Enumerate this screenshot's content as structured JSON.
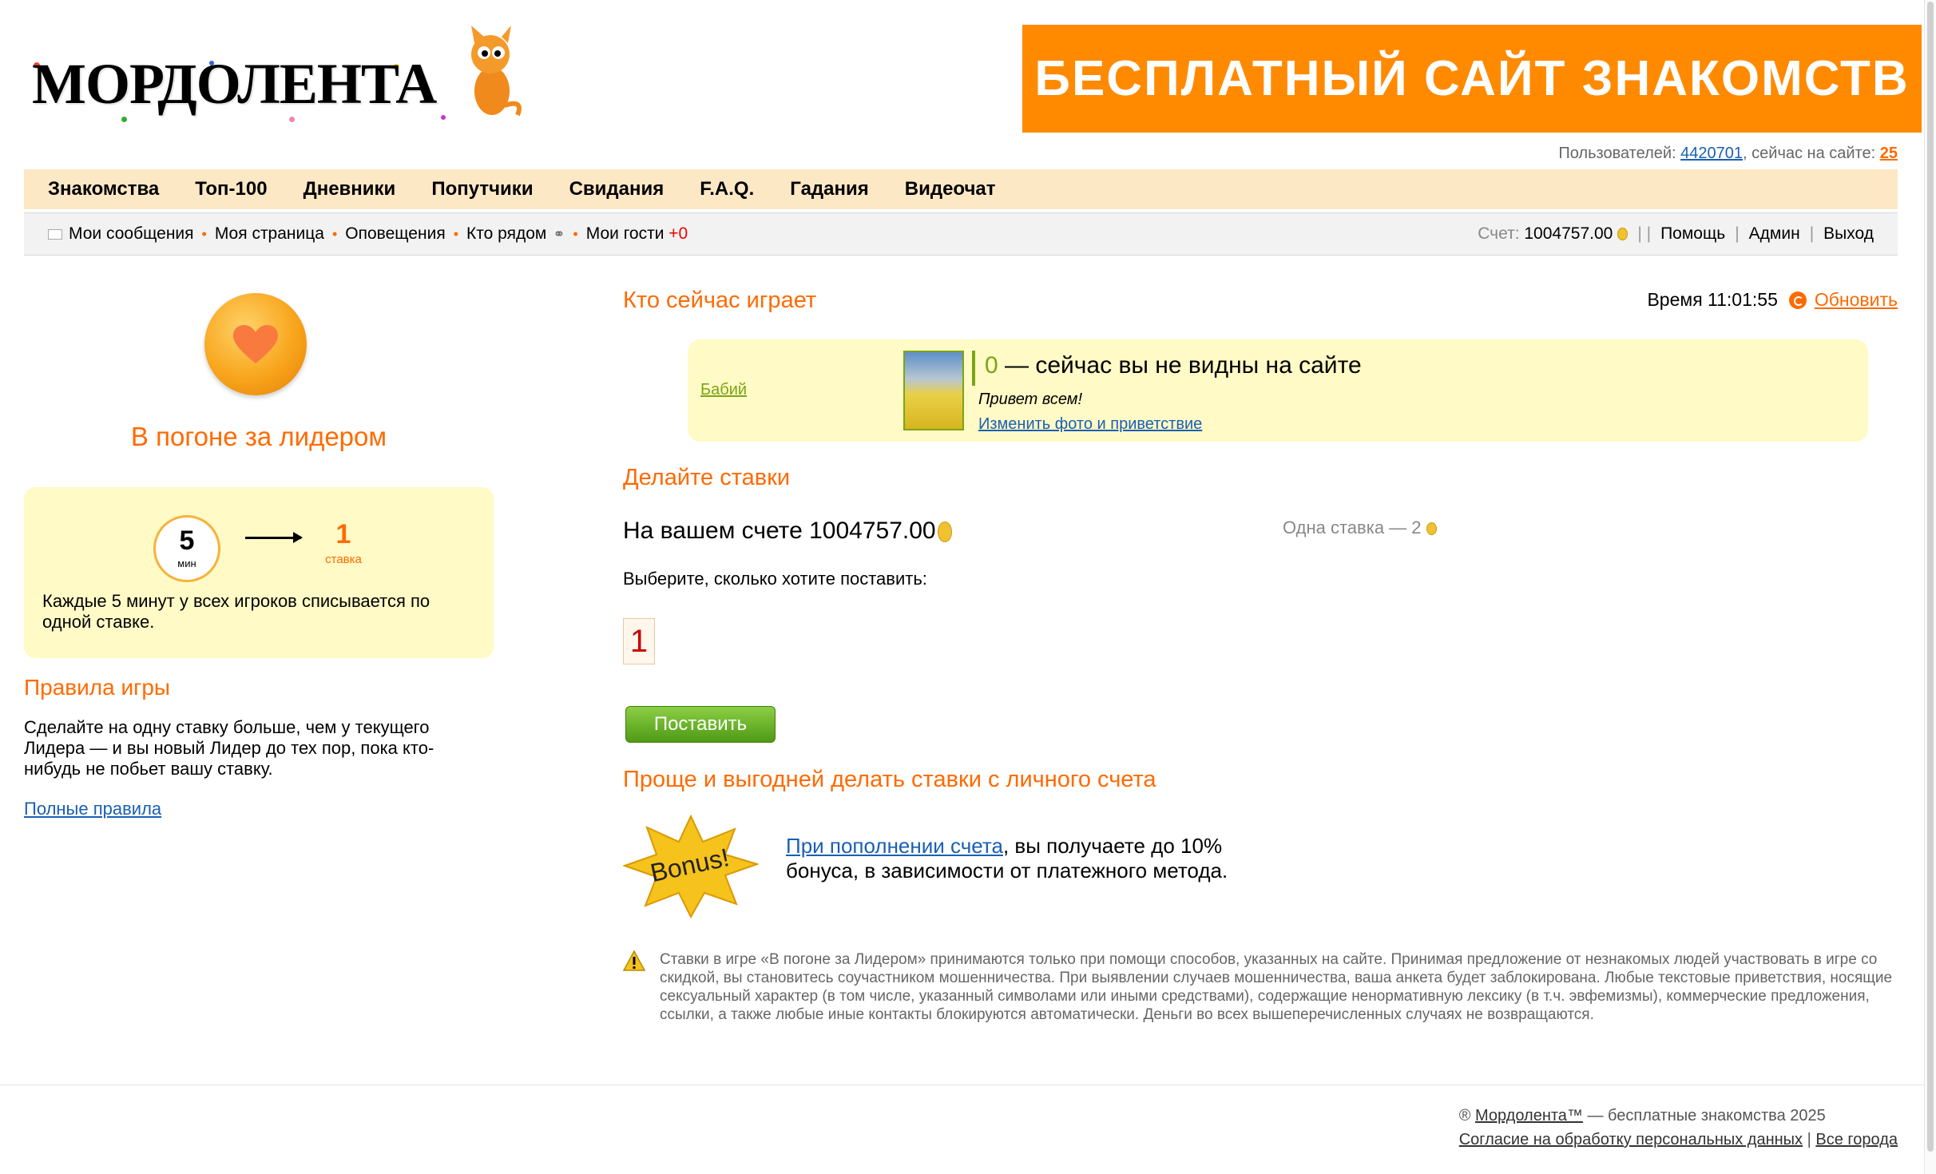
{
  "header": {
    "logo_text": "МОРДОЛЕНТА",
    "banner_text": "БЕСПЛАТНЫЙ САЙТ ЗНАКОМСТВ",
    "users_label": "Пользователей:",
    "users_count": "4420701",
    "online_label": ", сейчас на сайте:",
    "online_count": "25"
  },
  "main_nav": [
    "Знакомства",
    "Топ-100",
    "Дневники",
    "Попутчики",
    "Свидания",
    "F.A.Q.",
    "Гадания",
    "Видеочат"
  ],
  "sub_nav": {
    "messages": "Мои сообщения",
    "my_page": "Моя страница",
    "notifications": "Оповещения",
    "nearby": "Кто рядом",
    "guests": "Мои гости",
    "guests_count": "+0",
    "account_label": "Счет:",
    "account_value": "1004757.00",
    "help": "Помощь",
    "admin": "Админ",
    "logout": "Выход"
  },
  "left": {
    "title": "В погоне за лидером",
    "timer_value": "5",
    "timer_unit": "мин",
    "stake_value": "1",
    "stake_unit": "ставка",
    "box_text": "Каждые 5 минут у всех игроков списывается по одной ставке.",
    "rules_title": "Правила игры",
    "rules_text": "Сделайте на одну ставку больше, чем у текущего Лидера — и вы новый Лидер до тех пор, пока кто-нибудь не побьет вашу ставку.",
    "rules_link": "Полные правила"
  },
  "right": {
    "playing_title": "Кто сейчас играет",
    "time_label": "Время 11:01:55",
    "refresh": "Обновить",
    "player_name": "Бабий",
    "player_count": "0",
    "player_status": " — сейчас вы не видны на сайте",
    "player_greeting": "Привет всем!",
    "player_edit": "Изменить фото и приветствие",
    "bets_title": "Делайте ставки",
    "balance_text": "На вашем счете 1004757.00",
    "one_bet": "Одна ставка — 2",
    "choose_text": "Выберите, сколько хотите поставить:",
    "bet_value": "1",
    "place_button": "Поставить",
    "easier_title": "Проще и выгодней делать ставки с личного счета",
    "bonus_badge": "Bonus!",
    "bonus_link": "При пополнении счета",
    "bonus_text": ", вы получаете до 10% бонуса, в зависимости от платежного метода.",
    "disclaimer": "Ставки в игре «В погоне за Лидером» принимаются только при помощи способов, указанных на сайте. Принимая предложение от незнакомых людей участвовать в игре со скидкой, вы становитесь соучастником мошенничества. При выявлении случаев мошенничества, ваша анкета будет заблокирована. Любые текстовые приветствия, носящие сексуальный характер (в том числе, указанный символами или иными средствами), содержащие ненормативную лексику (в т.ч. эвфемизмы), коммерческие предложения, ссылки, а также любые иные контакты блокируются автоматически. Деньги во всех вышеперечисленных случаях не возвращаются."
  },
  "footer": {
    "copyright_sign": "®",
    "site_link": "Мордолента™",
    "copyright_text": " — бесплатные знакомства 2025",
    "consent_link": "Согласие на обработку персональных данных",
    "cities_link": "Все города"
  },
  "colors": {
    "accent": "#ff6a00",
    "banner": "#ff8a00",
    "nav_bg": "#fde8c6",
    "yellow_box": "#fffac6",
    "green": "#7aa614"
  }
}
